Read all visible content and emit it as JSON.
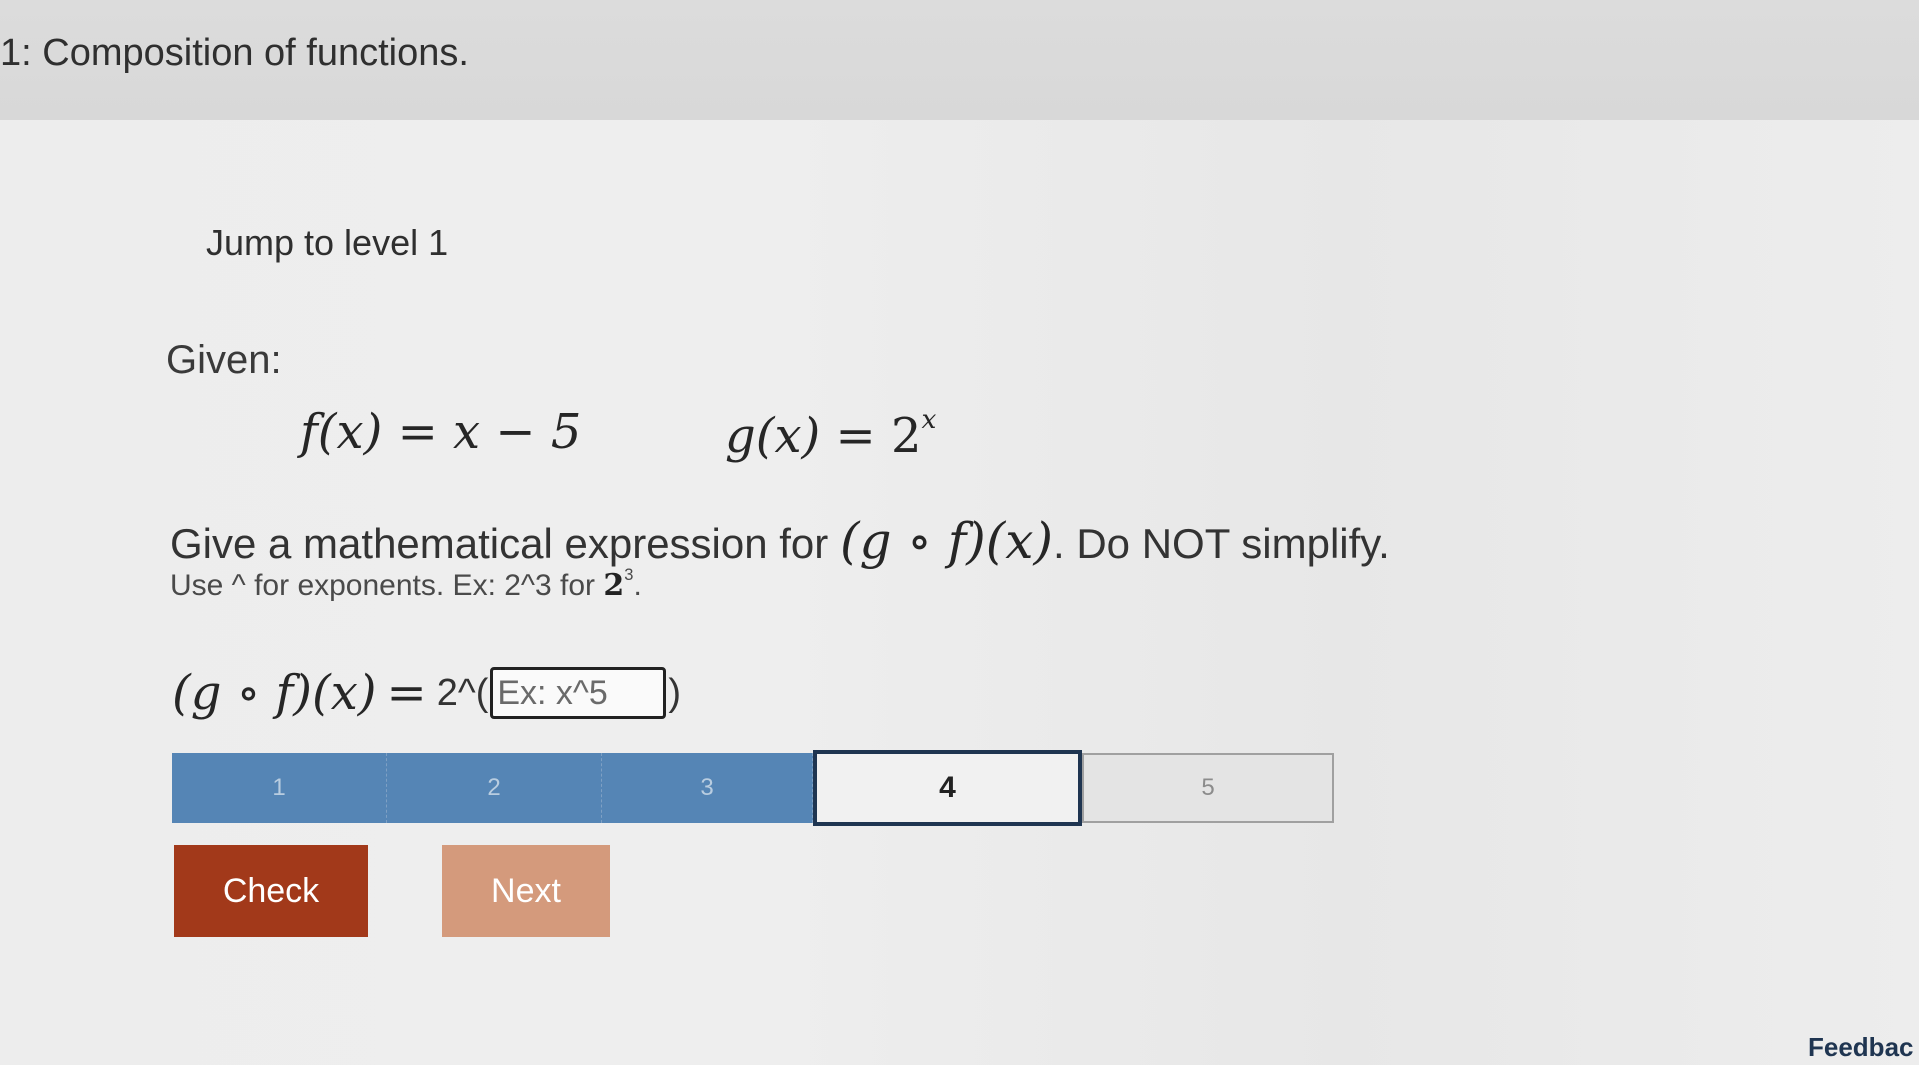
{
  "header": {
    "title": "1: Composition of functions."
  },
  "jump": {
    "label": "Jump to level 1"
  },
  "given": {
    "label": "Given:",
    "f_lhs": "f(x)",
    "f_rhs": "x − 5",
    "g_lhs": "g(x)",
    "g_base": "2",
    "g_exp": "x"
  },
  "prompt": {
    "before": "Give a mathematical expression for",
    "math": "(g ∘ f)(x)",
    "after": ". Do NOT simplify.",
    "hint_before": "Use ^ for exponents. Ex: 2^3 for",
    "hint_base": "2",
    "hint_exp": "3",
    "hint_after": "."
  },
  "answer": {
    "lhs": "(g ∘ f)(x)",
    "equals": "=",
    "prefix": "2^(",
    "placeholder": "Ex: x^5",
    "value": "",
    "suffix": ")"
  },
  "progress": {
    "current_level": 4,
    "levels": [
      "1",
      "2",
      "3",
      "4",
      "5"
    ],
    "done_color": "#5585b5",
    "current_border_color": "#1f3551"
  },
  "buttons": {
    "check_label": "Check",
    "next_label": "Next",
    "check_color": "#a2391a",
    "next_color": "#d49a7c"
  },
  "footer": {
    "feedback_label": "Feedbac"
  }
}
